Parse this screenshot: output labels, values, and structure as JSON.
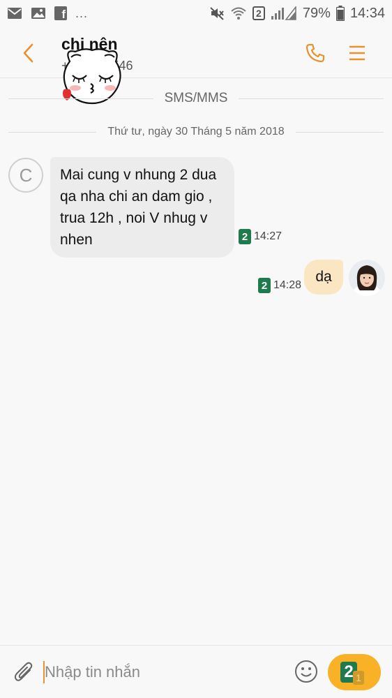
{
  "status_bar": {
    "battery_percent": "79%",
    "time": "14:34",
    "sim_indicator": "2",
    "overflow": "...",
    "icons": [
      "mail-icon",
      "image-icon",
      "facebook-icon",
      "mute-icon",
      "wifi-icon",
      "signal-icon",
      "battery-icon"
    ]
  },
  "header": {
    "contact_name": "chị nên",
    "contact_number_partial_left": "+",
    "contact_number_partial_right": "546",
    "icons": [
      "back-icon",
      "phone-icon",
      "menu-icon"
    ],
    "accent_color": "#e7922c"
  },
  "conversation": {
    "channel_label": "SMS/MMS",
    "date_label": "Thứ tư, ngày 30 Tháng 5 năm 2018",
    "messages": [
      {
        "direction": "incoming",
        "avatar_letter": "C",
        "text": "Mai cung v nhung 2 dua qa nha chi an dam gio , trua 12h , noi V nhug v nhen",
        "sim": "2",
        "time": "14:27"
      },
      {
        "direction": "outgoing",
        "text": "dạ",
        "sim": "2",
        "time": "14:28"
      }
    ]
  },
  "composer": {
    "placeholder": "Nhập tin nhắn",
    "send_sim": "2",
    "send_sim_sub": "1",
    "icons": [
      "attach-icon",
      "emoji-icon",
      "send-icon"
    ],
    "send_color": "#f9b227"
  }
}
